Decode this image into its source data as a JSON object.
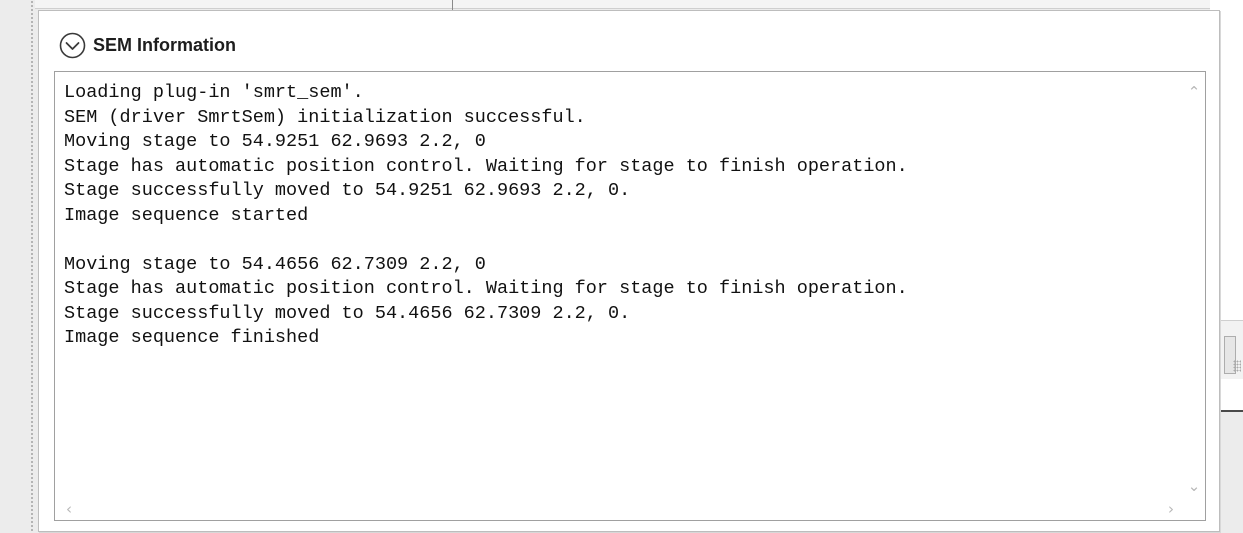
{
  "panel": {
    "title": "SEM Information",
    "collapse_icon": "chevron-down-circle-icon"
  },
  "log": {
    "lines": [
      "Loading plug-in 'smrt_sem'.",
      "SEM (driver SmrtSem) initialization successful.",
      "Moving stage to 54.9251 62.9693 2.2, 0",
      "Stage has automatic position control. Waiting for stage to finish operation.",
      "Stage successfully moved to 54.9251 62.9693 2.2, 0.",
      "Image sequence started",
      "",
      "Moving stage to 54.4656 62.7309 2.2, 0",
      "Stage has automatic position control. Waiting for stage to finish operation.",
      "Stage successfully moved to 54.4656 62.7309 2.2, 0.",
      "Image sequence finished"
    ]
  },
  "scrollbars": {
    "up_icon": "chevron-up-icon",
    "down_icon": "chevron-down-icon",
    "left_icon": "chevron-left-icon",
    "right_icon": "chevron-right-icon",
    "arrow_color": "#b8b8b8"
  }
}
